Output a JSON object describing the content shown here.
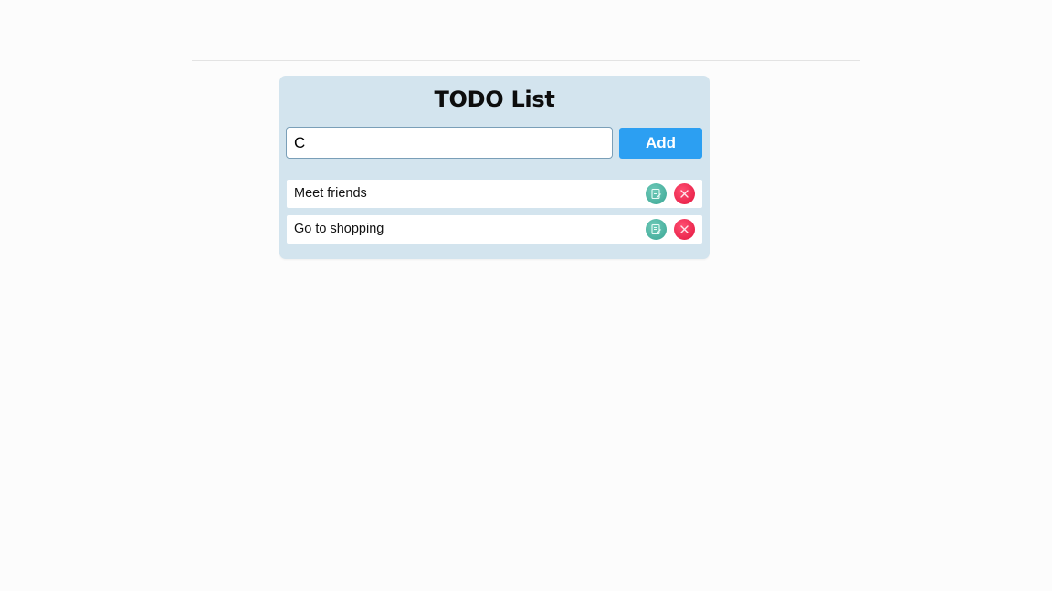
{
  "app": {
    "title": "TODO List"
  },
  "input": {
    "value": "C",
    "placeholder": ""
  },
  "add_button": {
    "label": "Add"
  },
  "tasks": [
    {
      "text": "Meet friends"
    },
    {
      "text": "Go to shopping"
    }
  ],
  "colors": {
    "card_bg": "#d3e4ee",
    "add_button": "#2c9ff2",
    "edit_icon": "#3aa694",
    "delete_icon": "#e3163f"
  },
  "icons": {
    "edit": "edit-icon",
    "delete": "close-icon"
  }
}
